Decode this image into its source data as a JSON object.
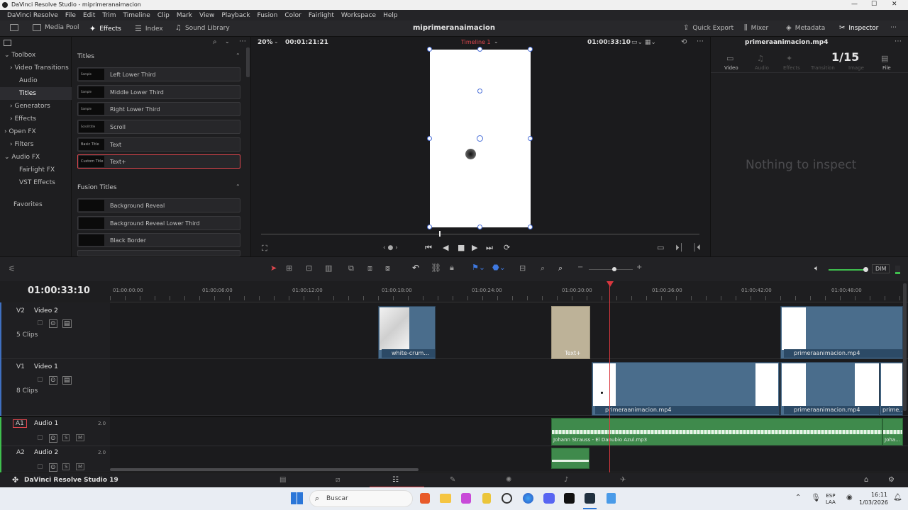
{
  "window": {
    "title": "DaVinci Resolve Studio - miprimeranaimacion"
  },
  "menu": [
    "DaVinci Resolve",
    "File",
    "Edit",
    "Trim",
    "Timeline",
    "Clip",
    "Mark",
    "View",
    "Playback",
    "Fusion",
    "Color",
    "Fairlight",
    "Workspace",
    "Help"
  ],
  "toolbar": {
    "media_pool": "Media Pool",
    "effects": "Effects",
    "index": "Index",
    "sound_library": "Sound Library",
    "project_name": "miprimeranaimacion",
    "quick_export": "Quick Export",
    "mixer": "Mixer",
    "metadata": "Metadata",
    "inspector": "Inspector"
  },
  "left_tree": {
    "toolbox": "Toolbox",
    "video_transitions": "Video Transitions",
    "audio_transitions": "Audio Transitions",
    "titles": "Titles",
    "generators": "Generators",
    "effects": "Effects",
    "open_fx": "Open FX",
    "filters": "Filters",
    "audio_fx": "Audio FX",
    "fairlight_fx": "Fairlight FX",
    "vst_effects": "VST Effects",
    "favorites": "Favorites"
  },
  "titles_panel": {
    "header": "Titles",
    "items": [
      {
        "label": "Left Lower Third",
        "thumb": "Sample"
      },
      {
        "label": "Middle Lower Third",
        "thumb": "Sample"
      },
      {
        "label": "Right Lower Third",
        "thumb": "Sample"
      },
      {
        "label": "Scroll",
        "thumb": "Scroll title"
      },
      {
        "label": "Text",
        "thumb": "Basic Title"
      },
      {
        "label": "Text+",
        "thumb": "Custom Title"
      }
    ],
    "fusion_header": "Fusion Titles",
    "fusion_items": [
      {
        "label": "Background Reveal"
      },
      {
        "label": "Background Reveal Lower Third"
      },
      {
        "label": "Black Border"
      }
    ]
  },
  "viewer": {
    "zoom": "20%",
    "duration": "00:01:21:21",
    "timeline_name": "Timeline 1",
    "timecode": "01:00:33:10"
  },
  "inspector": {
    "clip_name": "primeraanimacion.mp4",
    "counter": "1/15",
    "tabs": [
      "Video",
      "Audio",
      "Effects",
      "Transition",
      "Image",
      "File"
    ],
    "empty": "Nothing to inspect"
  },
  "timeline": {
    "timecode": "01:00:33:10",
    "dim": "DIM",
    "ruler": [
      "01:00:00:00",
      "01:00:06:00",
      "01:00:12:00",
      "01:00:18:00",
      "01:00:24:00",
      "01:00:30:00",
      "01:00:36:00",
      "01:00:42:00",
      "01:00:48:00"
    ],
    "tracks": {
      "v2": {
        "id": "V2",
        "name": "Video 2",
        "clips": "5 Clips"
      },
      "v1": {
        "id": "V1",
        "name": "Video 1",
        "clips": "8 Clips"
      },
      "a1": {
        "id": "A1",
        "name": "Audio 1",
        "ch": "2.0"
      },
      "a2": {
        "id": "A2",
        "name": "Audio 2",
        "ch": "2.0"
      }
    },
    "clips": {
      "white": "white-crum...",
      "textplus": "Text+",
      "prim1": "primeraanimacion.mp4",
      "prim2": "primeraanimacion.mp4",
      "prim3": "primeraanimacion.mp4",
      "prim4": "prime...",
      "audio1": "Johann Strauss - El Danubio Azul.mp3",
      "audio2": "Joha..."
    }
  },
  "pagebar": {
    "app": "DaVinci Resolve Studio 19"
  },
  "watermark": "xomer_zzz",
  "taskbar": {
    "search": "Buscar",
    "lang": "ESP",
    "lang2": "LAA",
    "time": "16:11",
    "date": "1/03/2026"
  },
  "colors": {
    "accent_red": "#e0474e",
    "clip_blue": "#4a6d8c",
    "audio_green": "#3f8a4c",
    "playhead": "#d9373e"
  }
}
